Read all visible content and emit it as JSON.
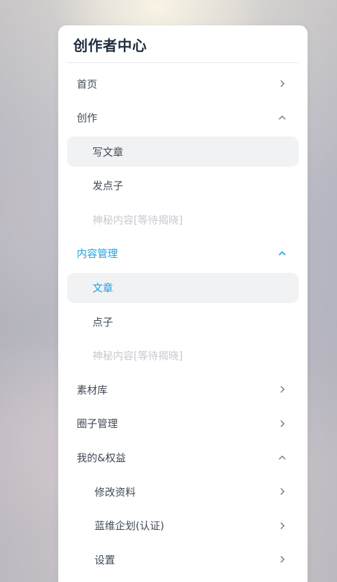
{
  "sidebar": {
    "title": "创作者中心",
    "items": [
      {
        "label": "首页",
        "icon": "chevron-right-icon"
      },
      {
        "label": "创作",
        "icon": "chevron-up-icon"
      },
      {
        "label": "写文章"
      },
      {
        "label": "发点子"
      },
      {
        "label": "神秘内容[等待揭晓]"
      },
      {
        "label": "内容管理",
        "icon": "chevron-up-icon"
      },
      {
        "label": "文章"
      },
      {
        "label": "点子"
      },
      {
        "label": "神秘内容[等待揭晓]"
      },
      {
        "label": "素材库",
        "icon": "chevron-right-icon"
      },
      {
        "label": "圈子管理",
        "icon": "chevron-right-icon"
      },
      {
        "label": "我的&权益",
        "icon": "chevron-up-icon"
      },
      {
        "label": "修改资料",
        "icon": "chevron-right-icon"
      },
      {
        "label": "蓝维企划(认证)",
        "icon": "chevron-right-icon"
      },
      {
        "label": "设置",
        "icon": "chevron-right-icon"
      }
    ]
  },
  "colors": {
    "accent": "#1e9fe0",
    "text": "#404a57",
    "disabled": "#c5c9cf",
    "selected_bg": "#f1f2f4"
  }
}
